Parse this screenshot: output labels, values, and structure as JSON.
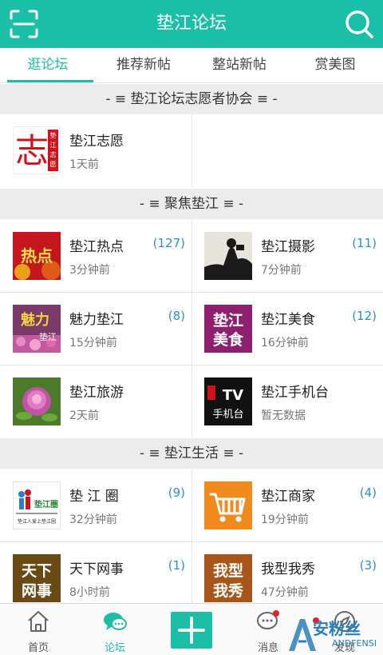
{
  "header": {
    "title": "垫江论坛"
  },
  "tabs": [
    {
      "label": "逛论坛"
    },
    {
      "label": "推荐新帖"
    },
    {
      "label": "整站新帖"
    },
    {
      "label": "赏美图"
    }
  ],
  "sections": [
    {
      "title": "- ≡ 垫江论坛志愿者协会 ≡ -"
    },
    {
      "title": "- ≡ 聚焦垫江 ≡ -"
    },
    {
      "title": "- ≡ 垫江生活 ≡ -"
    }
  ],
  "forums": [
    {
      "name": "垫江志愿",
      "time": "1天前",
      "count": "",
      "thumb_text": "志",
      "thumb_side": "垫江志愿"
    },
    {
      "name": "垫江热点",
      "time": "3分钟前",
      "count": "(127)",
      "thumb_text": "热点"
    },
    {
      "name": "垫江摄影",
      "time": "7分钟前",
      "count": "(11)"
    },
    {
      "name": "魅力垫江",
      "time": "15分钟前",
      "count": "(8)",
      "thumb_text": "魅力",
      "thumb_sub": "垫江"
    },
    {
      "name": "垫江美食",
      "time": "16分钟前",
      "count": "(12)",
      "thumb_text": "垫江",
      "thumb_sub": "美食"
    },
    {
      "name": "垫江旅游",
      "time": "2天前",
      "count": ""
    },
    {
      "name": "垫江手机台",
      "time": "暂无数据",
      "count": "",
      "thumb_text": "TV",
      "thumb_sub": "手机台"
    },
    {
      "name": "垫 江 圈",
      "time": "32分钟前",
      "count": "(9)",
      "thumb_text": "垫江圈",
      "thumb_sub": "垫江人爱上垫江圈"
    },
    {
      "name": "垫江商家",
      "time": "19分钟前",
      "count": "(4)"
    },
    {
      "name": "天下网事",
      "time": "8小时前",
      "count": "(1)",
      "thumb_text": "天下",
      "thumb_sub": "网事"
    },
    {
      "name": "我型我秀",
      "time": "47分钟前",
      "count": "(3)",
      "thumb_text": "我型",
      "thumb_sub": "我秀"
    }
  ],
  "bottom_nav": [
    {
      "label": "首页",
      "icon": "home-icon"
    },
    {
      "label": "论坛",
      "icon": "forum-icon"
    },
    {
      "label": "",
      "icon": "plus-icon"
    },
    {
      "label": "消息",
      "icon": "message-icon"
    },
    {
      "label": "发现",
      "icon": "discover-icon"
    }
  ],
  "watermark": {
    "text": "安粉丝",
    "sub": "ANDFENSI"
  },
  "colors": {
    "accent": "#1bbfa8",
    "count": "#2a8fd0",
    "section_bg": "#ececec"
  }
}
